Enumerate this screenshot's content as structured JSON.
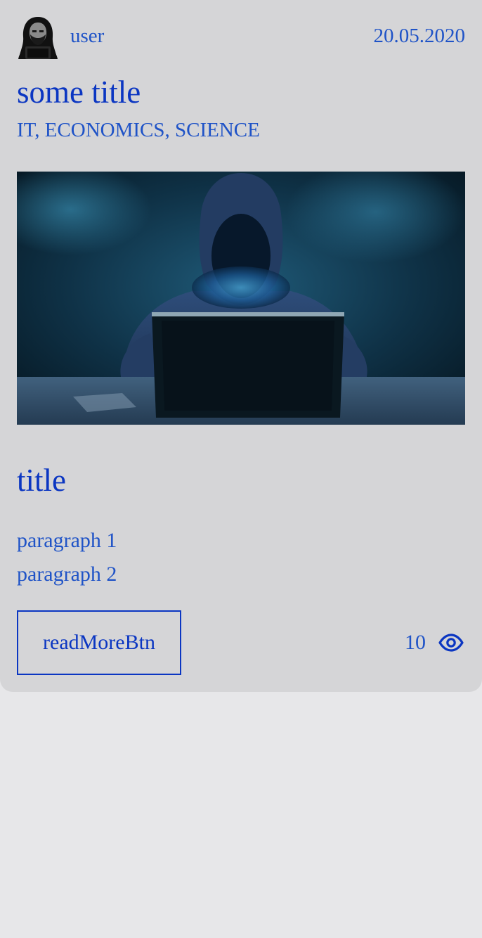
{
  "post": {
    "author": "user",
    "date": "20.05.2020",
    "title": "some title",
    "categories": "IT, ECONOMICS, SCIENCE",
    "content_title": "title",
    "paragraphs": [
      "paragraph 1",
      "paragraph 2"
    ],
    "read_more_label": "readMoreBtn",
    "views": "10"
  },
  "icons": {
    "avatar": "hooded-hacker-avatar",
    "views": "eye-icon"
  },
  "colors": {
    "accent": "#0b36c2",
    "text_link": "#1f53c7",
    "card_bg": "#d5d5d7",
    "page_bg": "#e7e7e9"
  }
}
